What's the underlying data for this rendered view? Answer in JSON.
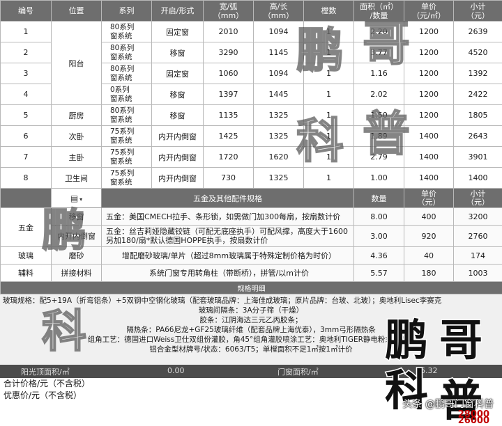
{
  "headers": [
    "编号",
    "位置",
    "系列",
    "开启/形式",
    "宽/弧\n（mm）",
    "高/长\n（mm）",
    "樘数",
    "面积（㎡）\n/数量",
    "单价\n（元/㎡）",
    "小计\n（元）"
  ],
  "rows": [
    {
      "no": "1",
      "location": "阳台",
      "series": "80系列\n窗系统",
      "type": "固定窗",
      "width": "2010",
      "height": "1094",
      "qty": "1",
      "area": "2.20",
      "price": "1200",
      "subtotal": "2639"
    },
    {
      "no": "2",
      "location": "",
      "series": "80系列\n窗系统",
      "type": "移窗",
      "width": "3290",
      "height": "1145",
      "qty": "1",
      "area": "3.77",
      "price": "1200",
      "subtotal": "4520"
    },
    {
      "no": "3",
      "location": "",
      "series": "80系列\n窗系统",
      "type": "固定窗",
      "width": "1060",
      "height": "1094",
      "qty": "1",
      "area": "1.16",
      "price": "1200",
      "subtotal": "1392"
    },
    {
      "no": "4",
      "location": "",
      "series": "0系列\n窗系统",
      "type": "移窗",
      "width": "1397",
      "height": "1445",
      "qty": "1",
      "area": "2.02",
      "price": "1200",
      "subtotal": "2422"
    },
    {
      "no": "5",
      "location": "厨房",
      "series": "80系列\n窗系统",
      "type": "移窗",
      "width": "1135",
      "height": "1325",
      "qty": "1",
      "area": "1.50",
      "price": "1200",
      "subtotal": "1805"
    },
    {
      "no": "6",
      "location": "次卧",
      "series": "75系列\n窗系统",
      "type": "内开内倒窗",
      "width": "1425",
      "height": "1325",
      "qty": "1",
      "area": "1.89",
      "price": "1400",
      "subtotal": "2643"
    },
    {
      "no": "7",
      "location": "主卧",
      "series": "75系列\n窗系统",
      "type": "内开内倒窗",
      "width": "1720",
      "height": "1620",
      "qty": "1",
      "area": "2.79",
      "price": "1400",
      "subtotal": "3901"
    },
    {
      "no": "8",
      "location": "卫生间",
      "series": "75系列\n窗系统",
      "type": "内开内倒窗",
      "width": "730",
      "height": "1325",
      "qty": "1",
      "area": "1.00",
      "price": "1400",
      "subtotal": "1400"
    }
  ],
  "hardware_header": {
    "title": "五金及其他配件规格",
    "qty": "数量",
    "price": "单价\n（元）",
    "subtotal": "小计\n（元）"
  },
  "hardware": [
    {
      "group": "五金",
      "item": "移窗",
      "desc": "五金：美国CMECH拉手、条形锁，如需做门加300每扇，按扇数计价",
      "qty": "8.00",
      "price": "400",
      "subtotal": "3200"
    },
    {
      "group": "",
      "item": "内开内倒窗",
      "desc": "五金：丝吉莉娅隐藏铰链（可配无底座执手）可配风撑，高度大于1600另加180/扇*默认德国HOPPE执手，按扇数计价",
      "qty": "3.00",
      "price": "920",
      "subtotal": "2760"
    },
    {
      "group": "玻璃",
      "item": "磨砂",
      "desc": "增配磨砂玻璃/单片（超过8mm玻璃属于特殊定制价格为时价）",
      "qty": "4.36",
      "price": "40",
      "subtotal": "174"
    },
    {
      "group": "辅料",
      "item": "拼接材料",
      "desc": "系统门窗专用转角柱（带断桥），拼管/以m计价",
      "qty": "5.57",
      "price": "180",
      "subtotal": "1003"
    }
  ],
  "spec_title": "规格明细",
  "spec_lines": [
    "玻璃规格：配5+19A（折弯铝条）+5双钢中空钢化玻璃（配套玻璃品牌：上海佳成玻璃；原片品牌：台玻、北玻）；奥地利Lisec李赛克",
    "玻璃间隔条：3A分子筛（干燥）",
    "胶条：江阴海达三元乙丙胶条；",
    "隔热条：PA66尼龙+GF25玻璃纤维（配套品牌上海优泰），3mm弓形隔热条",
    "组角工艺：德国进口Weiss卫仕双组份灌胶，角45°组角灌胶喷涂工艺：奥地利TIGER静电粉末喷涂；",
    "铝合金型材牌号/状态：6063/T5；单樘面积不足1㎡按1㎡计价"
  ],
  "area_bar": {
    "label1": "阳光顶面积/㎡",
    "value1": "0.00",
    "label2": "门窗面积/㎡",
    "value2": "16.32"
  },
  "totals": {
    "total_label": "合计价格/元（不含税）",
    "discount_label": "优惠价/元（不含税）",
    "total_value": "28000",
    "discount_value": "26000"
  },
  "watermarks": {
    "big1": "鹏",
    "big2": "科",
    "big3": "哥",
    "big4": "普"
  },
  "credit": "头条 @鹏哥门窗科普"
}
